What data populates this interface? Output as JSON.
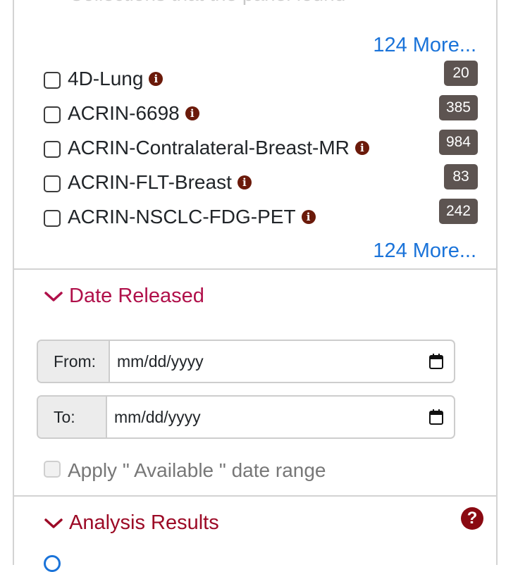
{
  "collections": {
    "partial_header": "Collections that the panel found",
    "more_link_top": "124 More...",
    "more_link_bottom": "124 More...",
    "items": [
      {
        "label": "4D-Lung",
        "count": "20"
      },
      {
        "label": "ACRIN-6698",
        "count": "385"
      },
      {
        "label": "ACRIN-Contralateral-Breast-MR",
        "count": "984"
      },
      {
        "label": "ACRIN-FLT-Breast",
        "count": "83"
      },
      {
        "label": "ACRIN-NSCLC-FDG-PET",
        "count": "242"
      }
    ],
    "info_glyph": "i"
  },
  "date_released": {
    "title": "Date Released",
    "from_label": "From:",
    "from_value": "mm/dd/yyyy",
    "to_label": "To:",
    "to_value": "mm/dd/yyyy",
    "apply_label": "Apply \" Available \" date range"
  },
  "analysis_results": {
    "title": "Analysis Results",
    "help_glyph": "?"
  },
  "colors": {
    "link": "#1a73d9",
    "section_header": "#b0104a",
    "badge": "#5d5451",
    "info_icon": "#6b1a0a"
  }
}
